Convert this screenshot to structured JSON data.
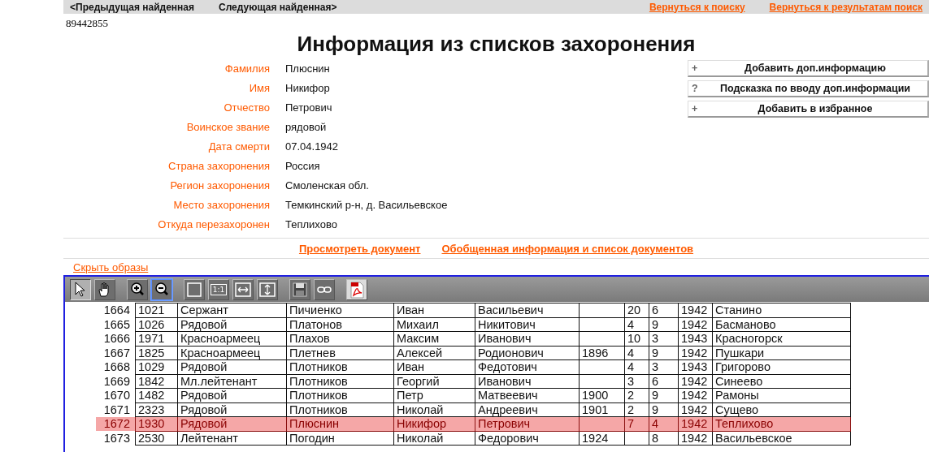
{
  "nav": {
    "left": [
      "<Предыдущая найденная",
      "Следующая найденная>"
    ],
    "right": [
      "Вернуться к поиску",
      "Вернуться к результатам поиск"
    ]
  },
  "record_id": "89442855",
  "title": "Информация из списков захоронения",
  "fields": [
    {
      "label": "Фамилия",
      "value": "Плюснин"
    },
    {
      "label": "Имя",
      "value": "Никифор"
    },
    {
      "label": "Отчество",
      "value": "Петрович"
    },
    {
      "label": "Воинское звание",
      "value": "рядовой"
    },
    {
      "label": "Дата смерти",
      "value": "07.04.1942"
    },
    {
      "label": "Страна захоронения",
      "value": "Россия"
    },
    {
      "label": "Регион захоронения",
      "value": "Смоленская обл."
    },
    {
      "label": "Место захоронения",
      "value": "Темкинский р-н, д. Васильевское"
    },
    {
      "label": "Откуда перезахоронен",
      "value": "Теплихово"
    }
  ],
  "actions": [
    {
      "icon": "+",
      "label": "Добавить доп.информацию"
    },
    {
      "icon": "?",
      "label": "Подсказка по вводу доп.информации"
    },
    {
      "icon": "+",
      "label": "Добавить в избранное"
    }
  ],
  "links": [
    "Просмотреть документ",
    "Обобщенная информация и список документов"
  ],
  "hide_images": "Скрыть образы",
  "toolbar": [
    {
      "kind": "pointer",
      "selected": true,
      "highlighted": false
    },
    {
      "kind": "hand",
      "selected": false,
      "highlighted": false
    },
    {
      "kind": "zoom-in",
      "selected": false,
      "highlighted": false
    },
    {
      "kind": "zoom-out",
      "selected": false,
      "highlighted": true
    },
    {
      "kind": "fit-page",
      "selected": false,
      "highlighted": false
    },
    {
      "kind": "actual-size",
      "label": "1:1",
      "selected": false,
      "highlighted": false
    },
    {
      "kind": "fit-width",
      "selected": false,
      "highlighted": false
    },
    {
      "kind": "fit-height",
      "selected": false,
      "highlighted": false
    },
    {
      "kind": "save",
      "selected": false,
      "highlighted": false
    },
    {
      "kind": "link",
      "selected": false,
      "highlighted": false
    },
    {
      "kind": "pdf",
      "selected": false,
      "highlighted": false
    }
  ],
  "document": {
    "rows": [
      {
        "selected": false,
        "cells": [
          "1664",
          "1021",
          "Сержант",
          "Пичиенко",
          "Иван",
          "Васильевич",
          "",
          "20",
          "6",
          "1942",
          "Станино"
        ]
      },
      {
        "selected": false,
        "cells": [
          "1665",
          "1026",
          "Рядовой",
          "Платонов",
          "Михаил",
          "Никитович",
          "",
          "4",
          "9",
          "1942",
          "Басманово"
        ]
      },
      {
        "selected": false,
        "cells": [
          "1666",
          "1971",
          "Красноармеец",
          "Плахов",
          "Максим",
          "Иванович",
          "",
          "10",
          "3",
          "1943",
          "Красногорск"
        ]
      },
      {
        "selected": false,
        "cells": [
          "1667",
          "1825",
          "Красноармеец",
          "Плетнев",
          "Алексей",
          "Родионович",
          "1896",
          "4",
          "9",
          "1942",
          "Пушкари"
        ]
      },
      {
        "selected": false,
        "cells": [
          "1668",
          "1029",
          "Рядовой",
          "Плотников",
          "Иван",
          "Федотович",
          "",
          "4",
          "3",
          "1943",
          "Григорово"
        ]
      },
      {
        "selected": false,
        "cells": [
          "1669",
          "1842",
          "Мл.лейтенант",
          "Плотников",
          "Георгий",
          "Иванович",
          "",
          "3",
          "6",
          "1942",
          "Синеево"
        ]
      },
      {
        "selected": false,
        "cells": [
          "1670",
          "1482",
          "Рядовой",
          "Плотников",
          "Петр",
          "Матвеевич",
          "1900",
          "2",
          "9",
          "1942",
          "Рамоны"
        ]
      },
      {
        "selected": false,
        "cells": [
          "1671",
          "2323",
          "Рядовой",
          "Плотников",
          "Николай",
          "Андреевич",
          "1901",
          "2",
          "9",
          "1942",
          "Сущево"
        ]
      },
      {
        "selected": true,
        "cells": [
          "1672",
          "1930",
          "Рядовой",
          "Плюснин",
          "Никифор",
          "Петрович",
          "",
          "7",
          "4",
          "1942",
          "Теплихово"
        ]
      },
      {
        "selected": false,
        "cells": [
          "1673",
          "2530",
          "Лейтенант",
          "Погодин",
          "Николай",
          "Федорович",
          "1924",
          "",
          "8",
          "1942",
          "Васильевское"
        ]
      }
    ]
  }
}
